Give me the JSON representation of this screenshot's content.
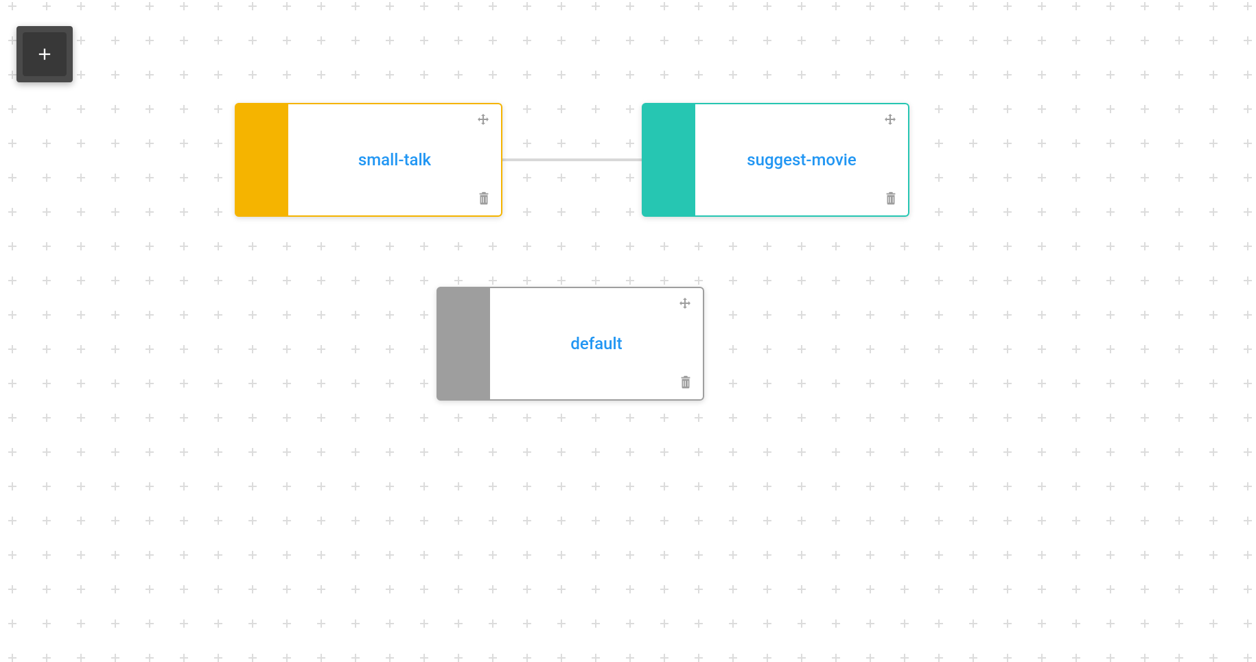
{
  "nodes": {
    "small_talk": {
      "label": "small-talk",
      "color": "#f5b400"
    },
    "suggest_movie": {
      "label": "suggest-movie",
      "color": "#26c6b2"
    },
    "default": {
      "label": "default",
      "color": "#9e9e9e"
    }
  },
  "edges": [
    {
      "from": "small-talk",
      "to": "suggest-movie"
    }
  ],
  "icons": {
    "add": "plus-icon",
    "move": "move-icon",
    "delete": "trash-icon"
  }
}
